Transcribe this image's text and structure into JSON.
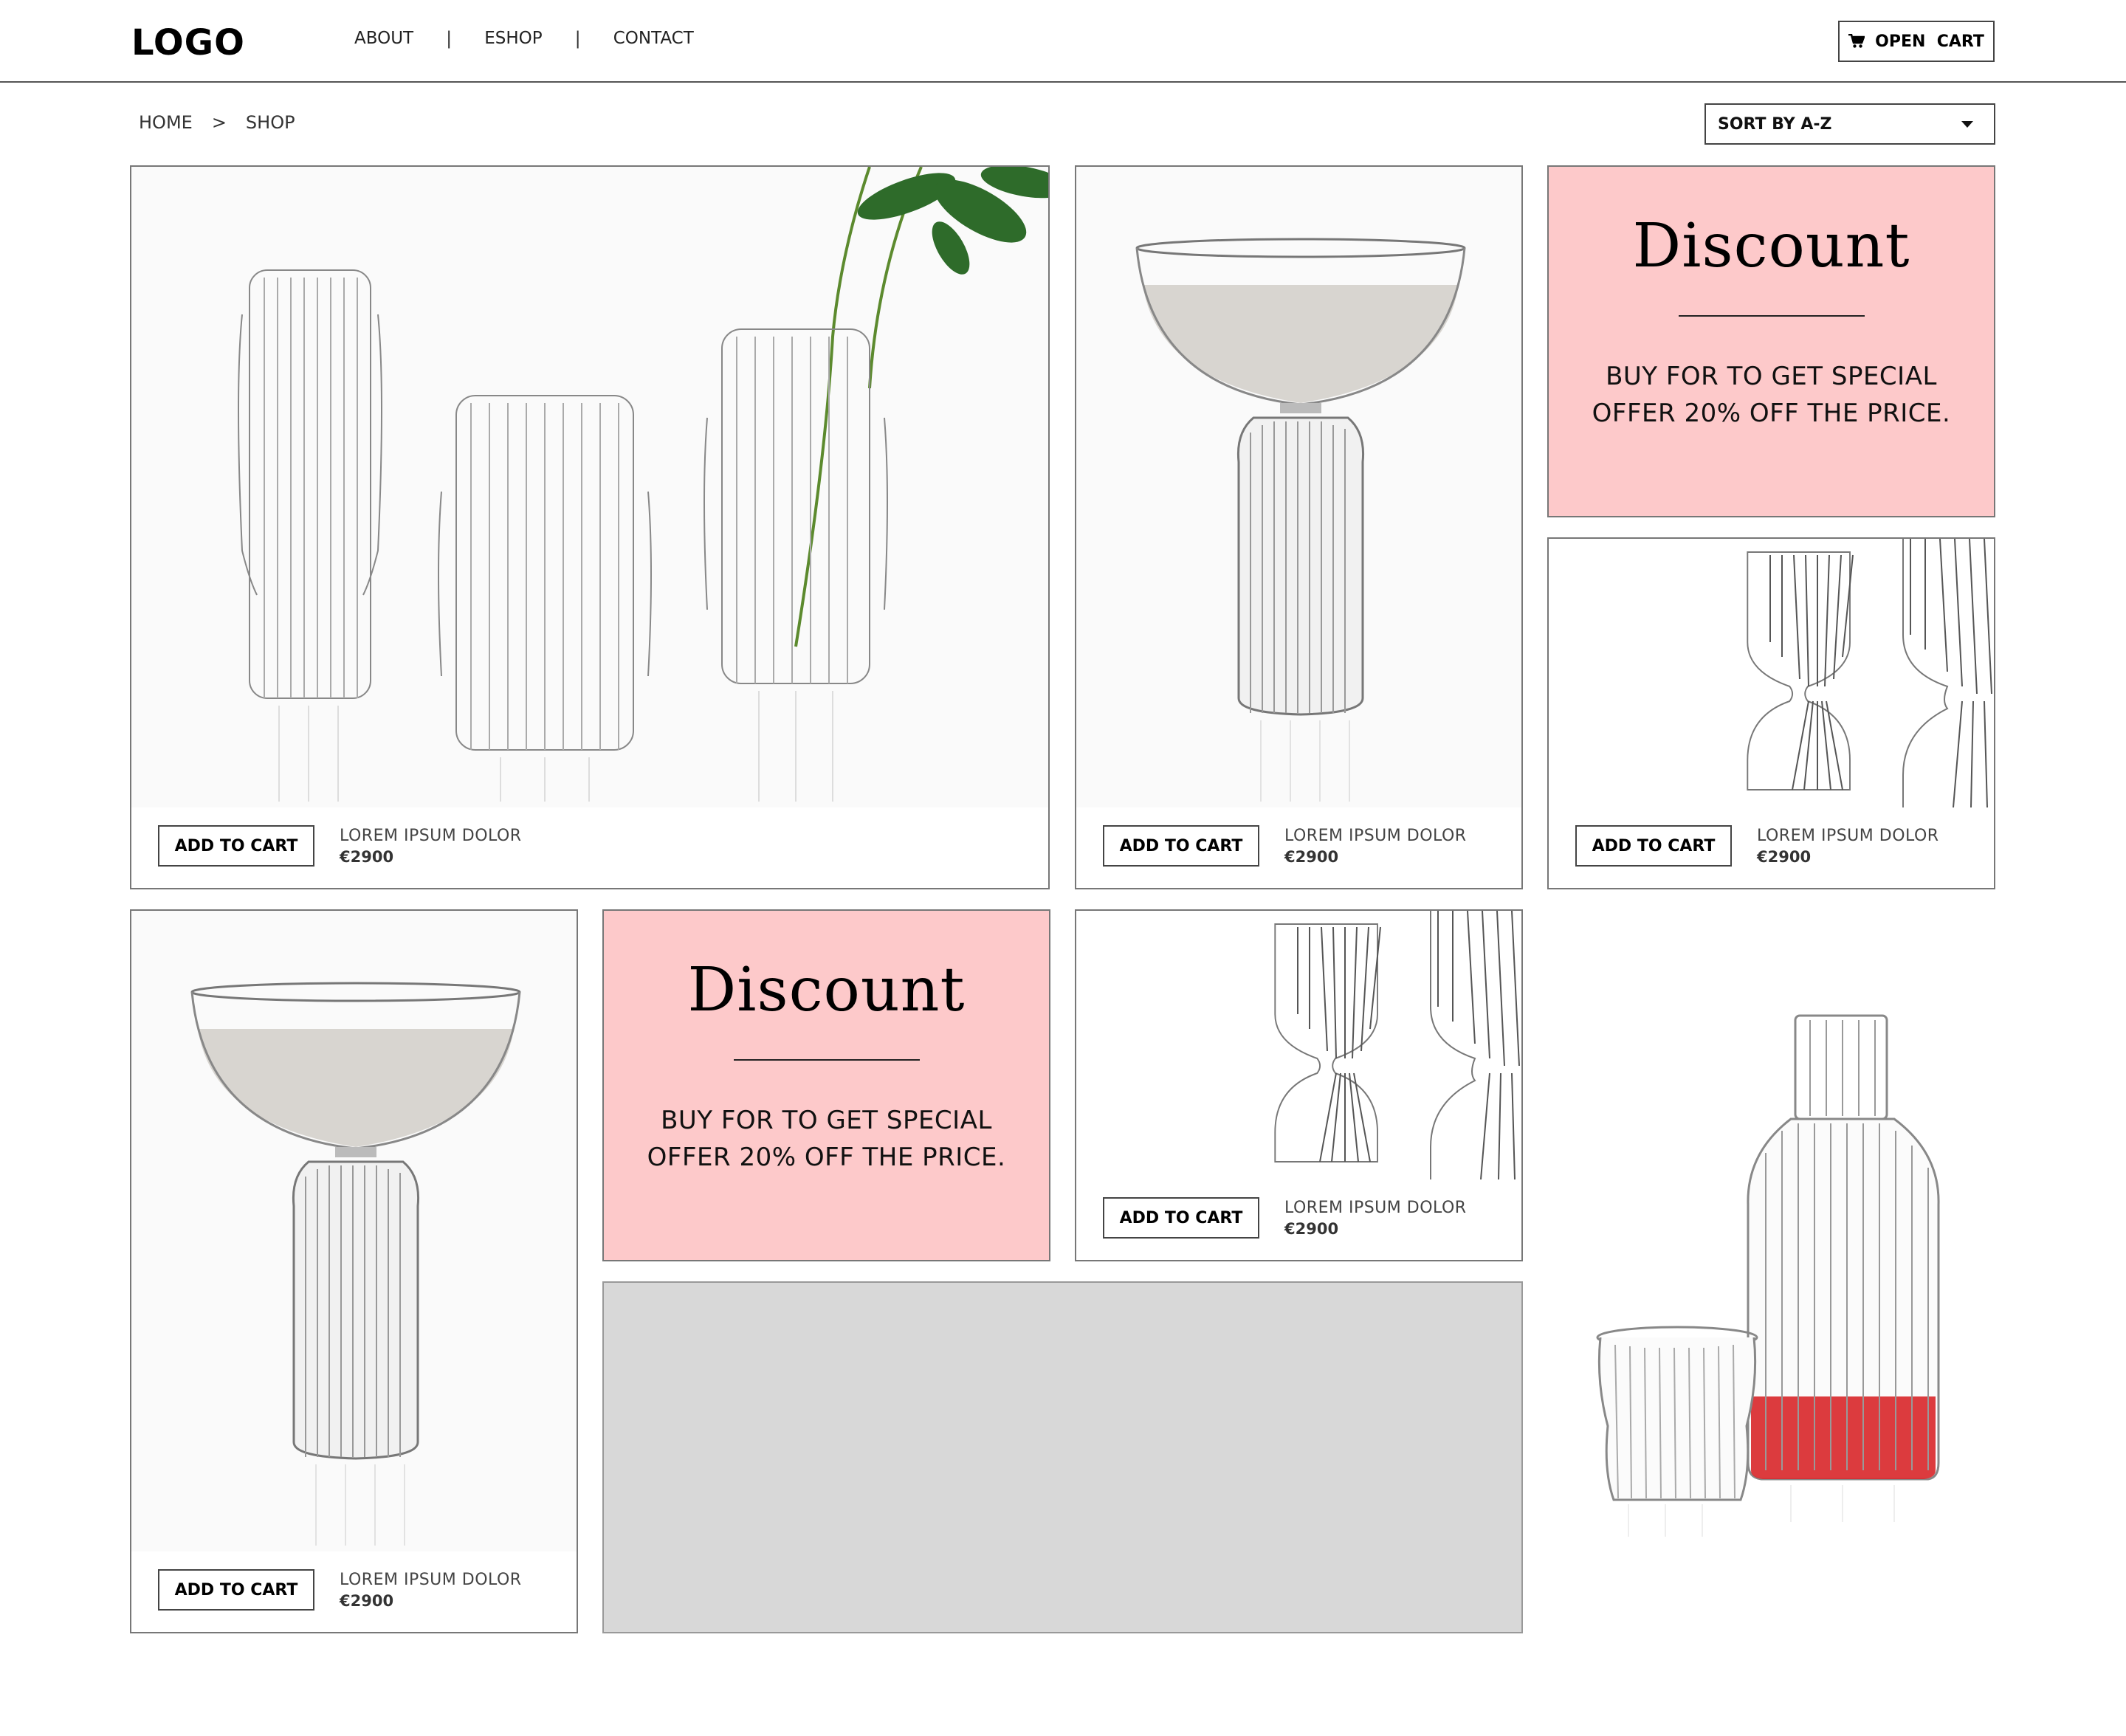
{
  "header": {
    "logo": "LOGO",
    "nav": [
      "ABOUT",
      "ESHOP",
      "CONTACT"
    ],
    "nav_separator": "|",
    "cart_label": "OPEN  CART"
  },
  "breadcrumb": [
    "HOME",
    ">",
    "SHOP"
  ],
  "sort": {
    "label": "SORT BY A-Z"
  },
  "products": [
    {
      "name": "LOREM IPSUM DOLOR",
      "price": "€2900",
      "button": "ADD TO CART",
      "image": "three-fluted-vases-with-plant"
    },
    {
      "name": "LOREM IPSUM DOLOR",
      "price": "€2900",
      "button": "ADD TO CART",
      "image": "coupe-glass-fluted-stem"
    },
    {
      "name": "LOREM IPSUM DOLOR",
      "price": "€2900",
      "button": "ADD TO CART",
      "image": "pinched-fluted-glasses"
    },
    {
      "name": "LOREM IPSUM DOLOR",
      "price": "€2900",
      "button": "ADD TO CART",
      "image": "coupe-glass-fluted-stem"
    },
    {
      "name": "LOREM IPSUM DOLOR",
      "price": "€2900",
      "button": "ADD TO CART",
      "image": "pinched-fluted-glasses"
    }
  ],
  "discounts": [
    {
      "title": "Discount",
      "line1": "BUY FOR TO GET SPECIAL",
      "line2": "OFFER 20% OFF THE PRICE."
    },
    {
      "title": "Discount",
      "line1": "BUY FOR TO GET SPECIAL",
      "line2": "OFFER 20% OFF THE PRICE."
    }
  ],
  "colors": {
    "discount_bg": "#fdc9ca",
    "placeholder_bg": "#d8d8d8",
    "border": "#777777",
    "liquid_red": "#d92a2e"
  }
}
